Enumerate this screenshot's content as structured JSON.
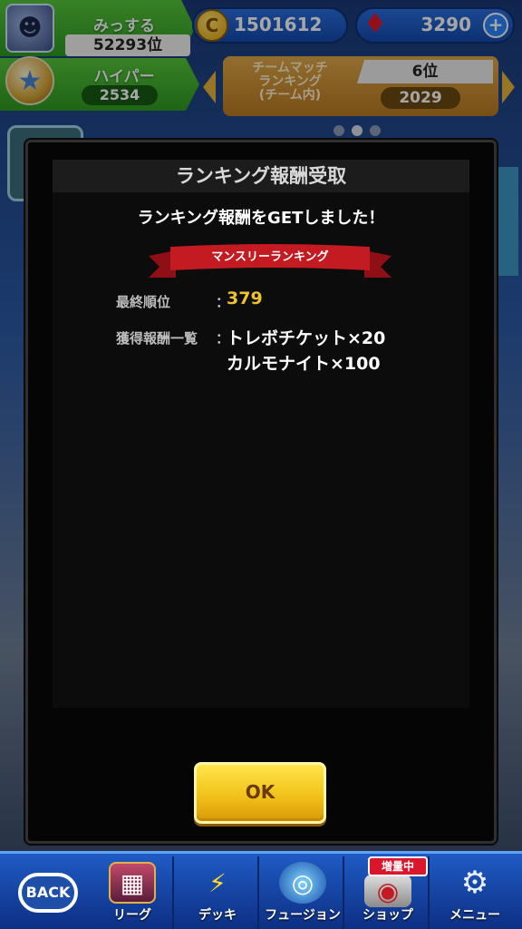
{
  "player": {
    "name": "みっする",
    "rank": "52293位",
    "tier": "ハイパー",
    "tier_score": "2534"
  },
  "currency": {
    "coin_symbol": "C",
    "coins": "1501612",
    "gems": "3290",
    "add_symbol": "+"
  },
  "team_match": {
    "label": "チームマッチ\nランキング\n(チーム内)",
    "rank": "6位",
    "score": "2029"
  },
  "modal": {
    "title": "ランキング報酬受取",
    "message": "ランキング報酬をGETしました！",
    "ribbon": "マンスリーランキング",
    "final_rank_label": "最終順位",
    "final_rank_value": "379",
    "rewards_label": "獲得報酬一覧",
    "colon": "：",
    "reward_1": "トレボチケット×20",
    "reward_2": "カルモナイト×100",
    "ok_label": "OK"
  },
  "nav": {
    "back": "BACK",
    "league": "リーグ",
    "deck": "デッキ",
    "fusion": "フュージョン",
    "shop": "ショップ",
    "shop_badge": "増量中",
    "menu": "メニュー"
  },
  "colors": {
    "accent_green": "#3aa82a",
    "gold": "#f2c12e",
    "ribbon_red": "#c41a22"
  }
}
